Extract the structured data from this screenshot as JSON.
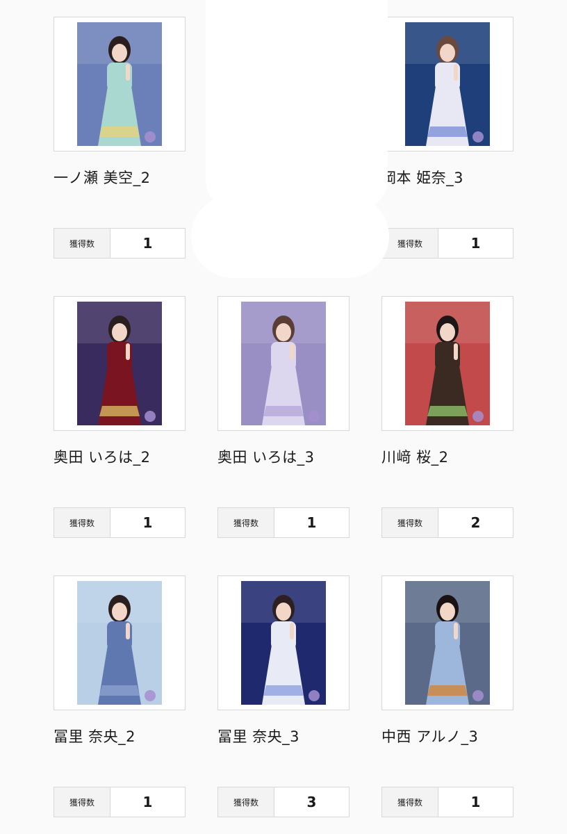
{
  "count_label": "獲得数",
  "cards": [
    {
      "name": "一ノ瀬 美空_2",
      "count": "1",
      "bg": "#6b7fb8",
      "dress": "#a8d8d0",
      "accent": "#e6d27a",
      "hair": "#2a1e1e"
    },
    {
      "name": "",
      "count": "",
      "bg": "#ffffff",
      "dress": "#ffffff",
      "accent": "#ffffff",
      "hair": "#ffffff"
    },
    {
      "name": "岡本 姫奈_3",
      "count": "1",
      "bg": "#1e3f7a",
      "dress": "#e8e8f4",
      "accent": "#7d8fd6",
      "hair": "#6a4a3e"
    },
    {
      "name": "奥田 いろは_2",
      "count": "1",
      "bg": "#3a2b5e",
      "dress": "#7a1420",
      "accent": "#d8b660",
      "hair": "#2a1e1e"
    },
    {
      "name": "奥田 いろは_3",
      "count": "1",
      "bg": "#9a8fc4",
      "dress": "#dcd6ee",
      "accent": "#b7a8d8",
      "hair": "#5a3e36"
    },
    {
      "name": "川﨑 桜_2",
      "count": "2",
      "bg": "#c24a4a",
      "dress": "#3a2a22",
      "accent": "#8fbf6a",
      "hair": "#1e1616"
    },
    {
      "name": "冨里 奈央_2",
      "count": "1",
      "bg": "#b8cfe6",
      "dress": "#5f78b0",
      "accent": "#8aa0cf",
      "hair": "#2a1e1e"
    },
    {
      "name": "冨里 奈央_3",
      "count": "3",
      "bg": "#1f2a6e",
      "dress": "#e8eaf6",
      "accent": "#8fa0e0",
      "hair": "#2e2020"
    },
    {
      "name": "中西 アルノ_3",
      "count": "1",
      "bg": "#5a6a88",
      "dress": "#9cb6dc",
      "accent": "#d2843a",
      "hair": "#1a1212"
    }
  ]
}
